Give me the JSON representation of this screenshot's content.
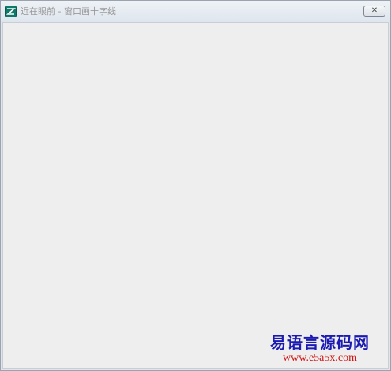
{
  "window": {
    "title": "近在眼前 - 窗口画十字线",
    "close_label": "✕"
  },
  "watermark": {
    "name": "易语言源码网",
    "url": "www.e5a5x.com"
  },
  "icons": {
    "app": "app-icon",
    "close": "close-icon"
  },
  "colors": {
    "client_background": "#eeeeee",
    "watermark_name": "#1b1bb3",
    "watermark_url": "#d01010"
  }
}
